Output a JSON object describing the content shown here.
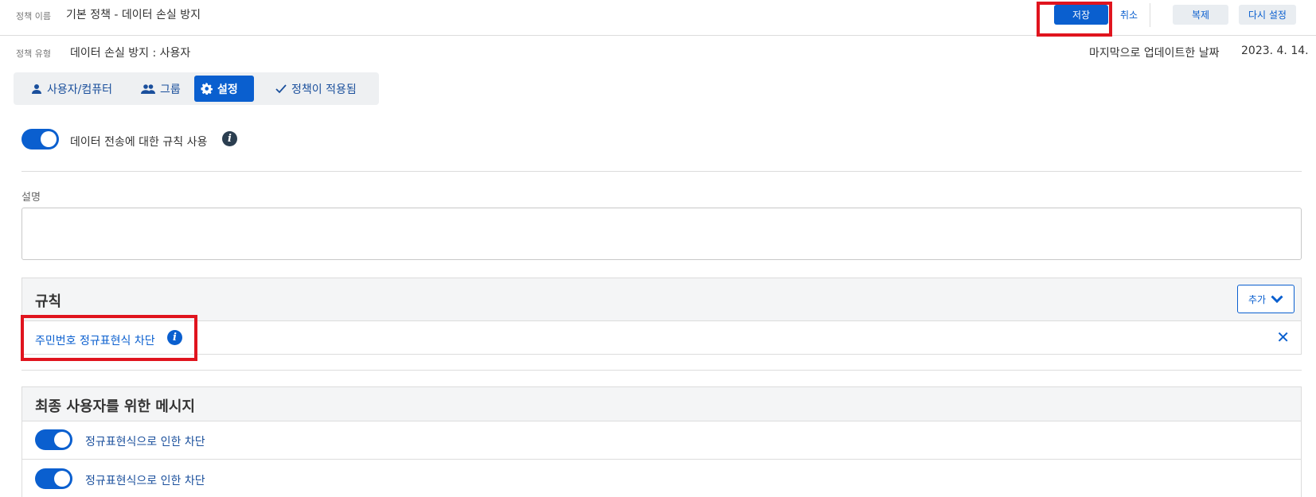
{
  "header": {
    "policy_name_label": "정책 이름",
    "policy_name": "기본 정책 - 데이터 손실 방지",
    "save_label": "저장",
    "cancel_label": "취소",
    "duplicate_label": "복제",
    "reset_label": "다시 설정"
  },
  "meta": {
    "policy_type_label": "정책 유형",
    "policy_type": "데이터 손실 방지 : 사용자",
    "last_updated_label": "마지막으로 업데이트한 날짜",
    "last_updated": "2023. 4. 14."
  },
  "tabs": [
    {
      "label": "사용자/컴퓨터",
      "icon": "user-icon",
      "active": false
    },
    {
      "label": "그룹",
      "icon": "group-icon",
      "active": false
    },
    {
      "label": "설정",
      "icon": "gear-icon",
      "active": true
    },
    {
      "label": "정책이 적용됨",
      "icon": "check-icon",
      "active": false
    }
  ],
  "settings": {
    "transfer_rules_label": "데이터 전송에 대한 규칙 사용",
    "transfer_rules_enabled": true,
    "description_label": "설명",
    "description_value": ""
  },
  "rules": {
    "title": "규칙",
    "add_label": "추가",
    "items": [
      {
        "label": "주민번호 정규표현식 차단"
      }
    ]
  },
  "messages": {
    "title": "최종 사용자를 위한 메시지",
    "items": [
      {
        "label": "정규표현식으로 인한 차단",
        "enabled": true
      },
      {
        "label": "정규표현식으로 인한 차단",
        "enabled": true
      }
    ]
  },
  "colors": {
    "accent": "#0a5fcf",
    "highlight": "#e0141e",
    "info_dark": "#2b3e50"
  }
}
